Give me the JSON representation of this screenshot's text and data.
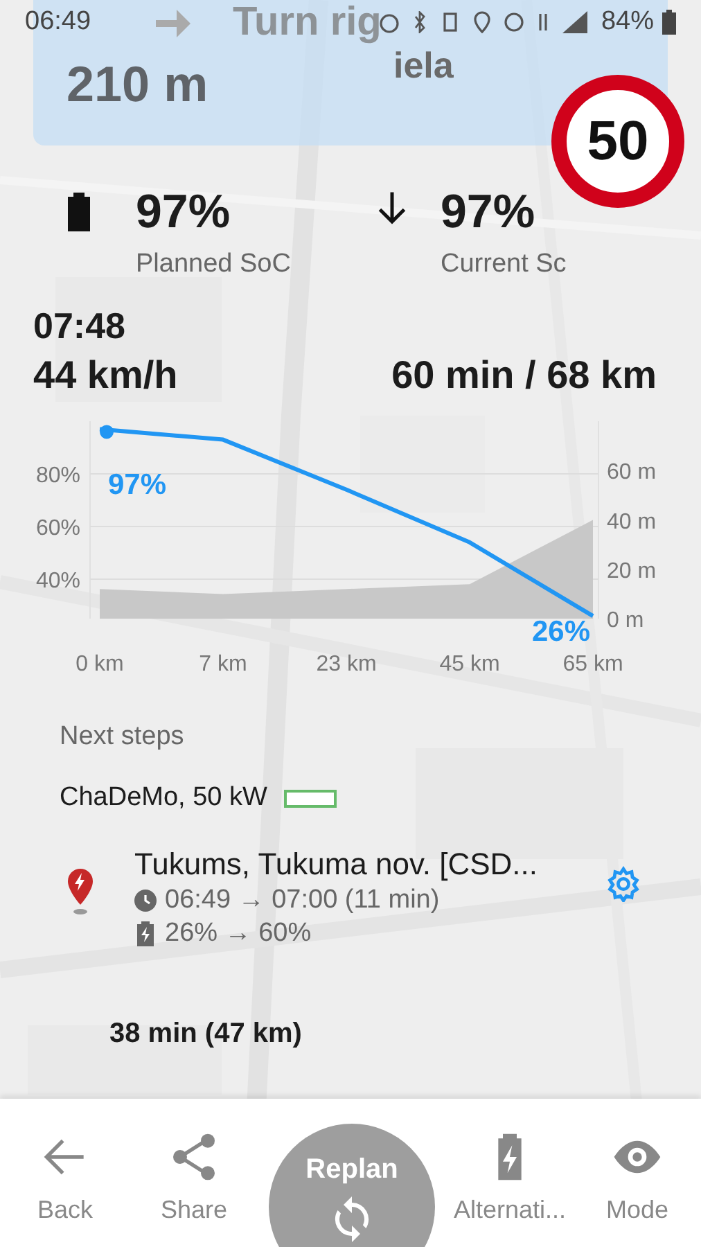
{
  "status_bar": {
    "time": "06:49",
    "battery": "84%"
  },
  "banner": {
    "instruction": "Turn rig",
    "instruction_line2": "iela",
    "distance": "210 m"
  },
  "speed_limit": "50",
  "soc": [
    {
      "kind": "planned",
      "value": "97%",
      "label": "Planned SoC"
    },
    {
      "kind": "current",
      "value": "97%",
      "label": "Current Sc"
    }
  ],
  "arrival_time": "07:48",
  "speed": "44 km/h",
  "remaining": "60 min / 68 km",
  "chart_data": {
    "type": "line",
    "categories": [
      "0 km",
      "7 km",
      "23 km",
      "45 km",
      "65 km"
    ],
    "series": [
      {
        "type": "area",
        "axis": "y2",
        "color": "#c8c8c8",
        "values": [
          12,
          10,
          12,
          14,
          40
        ]
      },
      {
        "color": "#2196f3",
        "values": [
          97,
          93,
          74,
          54,
          26
        ]
      }
    ],
    "grid": true,
    "ylim": [
      25,
      100
    ],
    "y2lim": [
      0,
      80
    ],
    "yticks": [
      {
        "value": 40,
        "label": "40%"
      },
      {
        "value": 60,
        "label": "60%"
      },
      {
        "value": 80,
        "label": "80%"
      }
    ],
    "y2ticks": [
      {
        "value": 0,
        "label": "0 m"
      },
      {
        "value": 20,
        "label": "20 m"
      },
      {
        "value": 40,
        "label": "40 m"
      },
      {
        "value": 60,
        "label": "60 m"
      }
    ],
    "annotations": [
      {
        "text": "97%",
        "x": "0 km",
        "y": 97
      },
      {
        "text": "26%",
        "x": "65 km",
        "y": 26
      }
    ]
  },
  "next_steps": {
    "heading": "Next steps",
    "connector": "ChaDeMo, 50 kW",
    "stop": {
      "name": "Tukums, Tukuma nov. [CSD...",
      "time": "06:49 → 07:00 (11 min)",
      "charge": "26% → 60%"
    },
    "leg": "38 min (47 km)"
  },
  "nav": [
    {
      "kind": "back",
      "label": "Back"
    },
    {
      "kind": "share",
      "label": "Share"
    },
    {
      "kind": "replan",
      "label": "Replan"
    },
    {
      "kind": "alternatives",
      "label": "Alternati..."
    },
    {
      "kind": "mode",
      "label": "Mode"
    }
  ]
}
